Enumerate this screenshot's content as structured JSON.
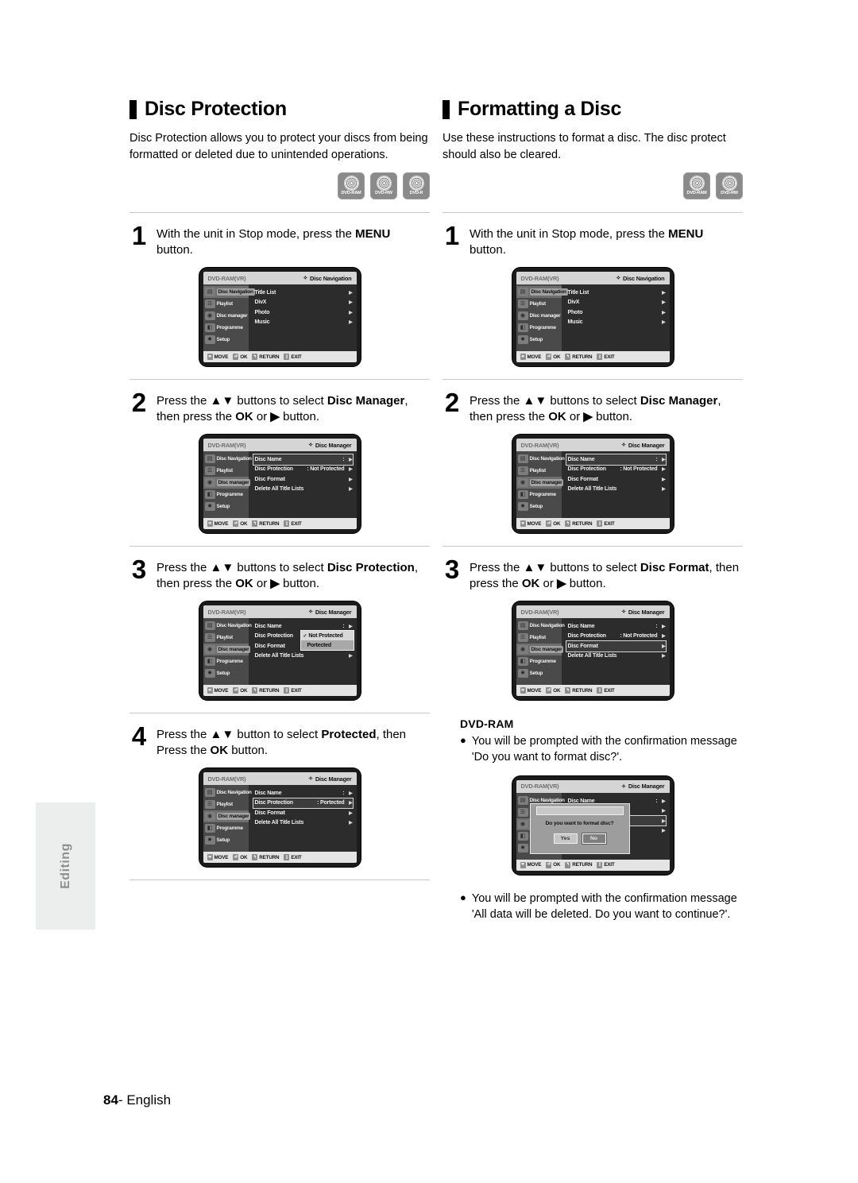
{
  "page": {
    "number": "84",
    "language": "English",
    "side_tab": "Editing"
  },
  "left_section": {
    "title": "Disc Protection",
    "intro": "Disc Protection allows you to protect your discs from being formatted or deleted due to unintended operations.",
    "badges": [
      "DVD-RAM",
      "DVD-RW",
      "DVD-R"
    ],
    "steps": [
      {
        "num": "1",
        "text_parts": [
          {
            "t": "With the unit in Stop mode, press the ",
            "b": false
          },
          {
            "t": "MENU",
            "b": true
          },
          {
            "t": " button.",
            "b": false
          }
        ]
      },
      {
        "num": "2",
        "text_parts": [
          {
            "t": "Press the ",
            "b": false
          },
          {
            "t": "▲▼",
            "b": true
          },
          {
            "t": " buttons to select ",
            "b": false
          },
          {
            "t": "Disc Manager",
            "b": true
          },
          {
            "t": ", then press the ",
            "b": false
          },
          {
            "t": "OK",
            "b": true
          },
          {
            "t": " or ",
            "b": false
          },
          {
            "t": "▶",
            "b": true
          },
          {
            "t": " button.",
            "b": false
          }
        ]
      },
      {
        "num": "3",
        "text_parts": [
          {
            "t": "Press the ",
            "b": false
          },
          {
            "t": "▲▼",
            "b": true
          },
          {
            "t": " buttons to select ",
            "b": false
          },
          {
            "t": "Disc Protection",
            "b": true
          },
          {
            "t": ", then press the ",
            "b": false
          },
          {
            "t": "OK",
            "b": true
          },
          {
            "t": " or ",
            "b": false
          },
          {
            "t": "▶",
            "b": true
          },
          {
            "t": " button.",
            "b": false
          }
        ]
      },
      {
        "num": "4",
        "text_parts": [
          {
            "t": "Press the ",
            "b": false
          },
          {
            "t": "▲▼",
            "b": true
          },
          {
            "t": " button to select ",
            "b": false
          },
          {
            "t": "Protected",
            "b": true
          },
          {
            "t": ", then Press the ",
            "b": false
          },
          {
            "t": "OK",
            "b": true
          },
          {
            "t": " button.",
            "b": false
          }
        ]
      }
    ]
  },
  "right_section": {
    "title": "Formatting a Disc",
    "intro": "Use these instructions to format a disc. The disc protect should also be cleared.",
    "badges": [
      "DVD-RAM",
      "DVD-RW"
    ],
    "steps": [
      {
        "num": "1",
        "text_parts": [
          {
            "t": "With the unit in Stop mode, press the ",
            "b": false
          },
          {
            "t": "MENU",
            "b": true
          },
          {
            "t": " button.",
            "b": false
          }
        ]
      },
      {
        "num": "2",
        "text_parts": [
          {
            "t": "Press the ",
            "b": false
          },
          {
            "t": "▲▼",
            "b": true
          },
          {
            "t": " buttons to select ",
            "b": false
          },
          {
            "t": "Disc Manager",
            "b": true
          },
          {
            "t": ", then press the ",
            "b": false
          },
          {
            "t": "OK",
            "b": true
          },
          {
            "t": " or ",
            "b": false
          },
          {
            "t": "▶",
            "b": true
          },
          {
            "t": " button.",
            "b": false
          }
        ]
      },
      {
        "num": "3",
        "text_parts": [
          {
            "t": "Press the ",
            "b": false
          },
          {
            "t": "▲▼",
            "b": true
          },
          {
            "t": " buttons to select ",
            "b": false
          },
          {
            "t": "Disc Format",
            "b": true
          },
          {
            "t": ", then press the ",
            "b": false
          },
          {
            "t": "OK",
            "b": true
          },
          {
            "t": " or ",
            "b": false
          },
          {
            "t": "▶",
            "b": true
          },
          {
            "t": " button.",
            "b": false
          }
        ]
      }
    ],
    "note": {
      "title": "DVD-RAM",
      "bullet1": "You will be prompted with the confirmation message 'Do you want to format disc?'.",
      "bullet2": "You will be prompted with the confirmation message 'All data will be deleted. Do you want to continue?'."
    }
  },
  "osd": {
    "disc_label": "DVD-RAM(VR)",
    "mode_nav": "Disc Navigation",
    "mode_mgr": "Disc Manager",
    "sidebar": [
      {
        "label": "Disc Navigation",
        "icon": "film-strip-icon"
      },
      {
        "label": "Playlist",
        "icon": "playlist-icon"
      },
      {
        "label": "Disc manager",
        "icon": "disc-icon"
      },
      {
        "label": "Programme",
        "icon": "programme-icon"
      },
      {
        "label": "Setup",
        "icon": "gear-icon"
      }
    ],
    "nav_rows": [
      {
        "label": "Title List",
        "value": "",
        "arrow": "▶"
      },
      {
        "label": "DivX",
        "value": "",
        "arrow": "▶"
      },
      {
        "label": "Photo",
        "value": "",
        "arrow": "▶"
      },
      {
        "label": "Music",
        "value": "",
        "arrow": "▶"
      }
    ],
    "mgr_rows_unprotected": [
      {
        "label": "Disc Name",
        "value": ":",
        "arrow": "▶"
      },
      {
        "label": "Disc Protection",
        "value": ": Not Protected",
        "arrow": "▶"
      },
      {
        "label": "Disc Format",
        "value": "",
        "arrow": "▶"
      },
      {
        "label": "Delete All Title Lists",
        "value": "",
        "arrow": "▶"
      }
    ],
    "mgr_rows_protected": [
      {
        "label": "Disc Name",
        "value": ":",
        "arrow": "▶"
      },
      {
        "label": "Disc Protection",
        "value": ": Portected",
        "arrow": "▶"
      },
      {
        "label": "Disc Format",
        "value": "",
        "arrow": "▶"
      },
      {
        "label": "Delete All Title Lists",
        "value": "",
        "arrow": "▶"
      }
    ],
    "dropdown": {
      "selected": "Not Protected",
      "other": "Portected",
      "check": "✓"
    },
    "dialog": {
      "message": "Do you want to format disc?",
      "yes": "Yes",
      "no": "No"
    },
    "footer_keys": [
      {
        "key": "≑",
        "label": "MOVE"
      },
      {
        "key": "⏎",
        "label": "OK"
      },
      {
        "key": "↰",
        "label": "RETURN"
      },
      {
        "key": "▯",
        "label": "EXIT"
      }
    ]
  }
}
